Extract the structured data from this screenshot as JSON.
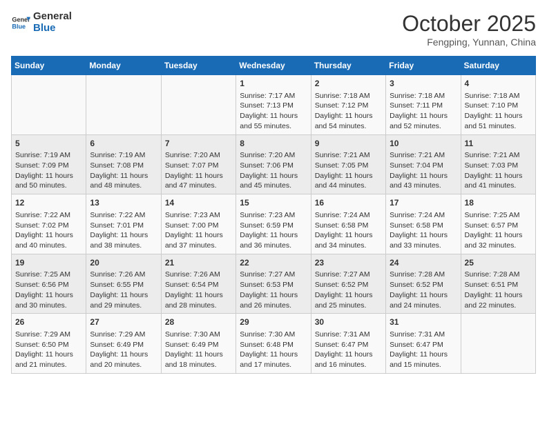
{
  "header": {
    "logo_line1": "General",
    "logo_line2": "Blue",
    "month": "October 2025",
    "location": "Fengping, Yunnan, China"
  },
  "days_of_week": [
    "Sunday",
    "Monday",
    "Tuesday",
    "Wednesday",
    "Thursday",
    "Friday",
    "Saturday"
  ],
  "weeks": [
    [
      {
        "day": "",
        "info": ""
      },
      {
        "day": "",
        "info": ""
      },
      {
        "day": "",
        "info": ""
      },
      {
        "day": "1",
        "info": "Sunrise: 7:17 AM\nSunset: 7:13 PM\nDaylight: 11 hours and 55 minutes."
      },
      {
        "day": "2",
        "info": "Sunrise: 7:18 AM\nSunset: 7:12 PM\nDaylight: 11 hours and 54 minutes."
      },
      {
        "day": "3",
        "info": "Sunrise: 7:18 AM\nSunset: 7:11 PM\nDaylight: 11 hours and 52 minutes."
      },
      {
        "day": "4",
        "info": "Sunrise: 7:18 AM\nSunset: 7:10 PM\nDaylight: 11 hours and 51 minutes."
      }
    ],
    [
      {
        "day": "5",
        "info": "Sunrise: 7:19 AM\nSunset: 7:09 PM\nDaylight: 11 hours and 50 minutes."
      },
      {
        "day": "6",
        "info": "Sunrise: 7:19 AM\nSunset: 7:08 PM\nDaylight: 11 hours and 48 minutes."
      },
      {
        "day": "7",
        "info": "Sunrise: 7:20 AM\nSunset: 7:07 PM\nDaylight: 11 hours and 47 minutes."
      },
      {
        "day": "8",
        "info": "Sunrise: 7:20 AM\nSunset: 7:06 PM\nDaylight: 11 hours and 45 minutes."
      },
      {
        "day": "9",
        "info": "Sunrise: 7:21 AM\nSunset: 7:05 PM\nDaylight: 11 hours and 44 minutes."
      },
      {
        "day": "10",
        "info": "Sunrise: 7:21 AM\nSunset: 7:04 PM\nDaylight: 11 hours and 43 minutes."
      },
      {
        "day": "11",
        "info": "Sunrise: 7:21 AM\nSunset: 7:03 PM\nDaylight: 11 hours and 41 minutes."
      }
    ],
    [
      {
        "day": "12",
        "info": "Sunrise: 7:22 AM\nSunset: 7:02 PM\nDaylight: 11 hours and 40 minutes."
      },
      {
        "day": "13",
        "info": "Sunrise: 7:22 AM\nSunset: 7:01 PM\nDaylight: 11 hours and 38 minutes."
      },
      {
        "day": "14",
        "info": "Sunrise: 7:23 AM\nSunset: 7:00 PM\nDaylight: 11 hours and 37 minutes."
      },
      {
        "day": "15",
        "info": "Sunrise: 7:23 AM\nSunset: 6:59 PM\nDaylight: 11 hours and 36 minutes."
      },
      {
        "day": "16",
        "info": "Sunrise: 7:24 AM\nSunset: 6:58 PM\nDaylight: 11 hours and 34 minutes."
      },
      {
        "day": "17",
        "info": "Sunrise: 7:24 AM\nSunset: 6:58 PM\nDaylight: 11 hours and 33 minutes."
      },
      {
        "day": "18",
        "info": "Sunrise: 7:25 AM\nSunset: 6:57 PM\nDaylight: 11 hours and 32 minutes."
      }
    ],
    [
      {
        "day": "19",
        "info": "Sunrise: 7:25 AM\nSunset: 6:56 PM\nDaylight: 11 hours and 30 minutes."
      },
      {
        "day": "20",
        "info": "Sunrise: 7:26 AM\nSunset: 6:55 PM\nDaylight: 11 hours and 29 minutes."
      },
      {
        "day": "21",
        "info": "Sunrise: 7:26 AM\nSunset: 6:54 PM\nDaylight: 11 hours and 28 minutes."
      },
      {
        "day": "22",
        "info": "Sunrise: 7:27 AM\nSunset: 6:53 PM\nDaylight: 11 hours and 26 minutes."
      },
      {
        "day": "23",
        "info": "Sunrise: 7:27 AM\nSunset: 6:52 PM\nDaylight: 11 hours and 25 minutes."
      },
      {
        "day": "24",
        "info": "Sunrise: 7:28 AM\nSunset: 6:52 PM\nDaylight: 11 hours and 24 minutes."
      },
      {
        "day": "25",
        "info": "Sunrise: 7:28 AM\nSunset: 6:51 PM\nDaylight: 11 hours and 22 minutes."
      }
    ],
    [
      {
        "day": "26",
        "info": "Sunrise: 7:29 AM\nSunset: 6:50 PM\nDaylight: 11 hours and 21 minutes."
      },
      {
        "day": "27",
        "info": "Sunrise: 7:29 AM\nSunset: 6:49 PM\nDaylight: 11 hours and 20 minutes."
      },
      {
        "day": "28",
        "info": "Sunrise: 7:30 AM\nSunset: 6:49 PM\nDaylight: 11 hours and 18 minutes."
      },
      {
        "day": "29",
        "info": "Sunrise: 7:30 AM\nSunset: 6:48 PM\nDaylight: 11 hours and 17 minutes."
      },
      {
        "day": "30",
        "info": "Sunrise: 7:31 AM\nSunset: 6:47 PM\nDaylight: 11 hours and 16 minutes."
      },
      {
        "day": "31",
        "info": "Sunrise: 7:31 AM\nSunset: 6:47 PM\nDaylight: 11 hours and 15 minutes."
      },
      {
        "day": "",
        "info": ""
      }
    ]
  ]
}
